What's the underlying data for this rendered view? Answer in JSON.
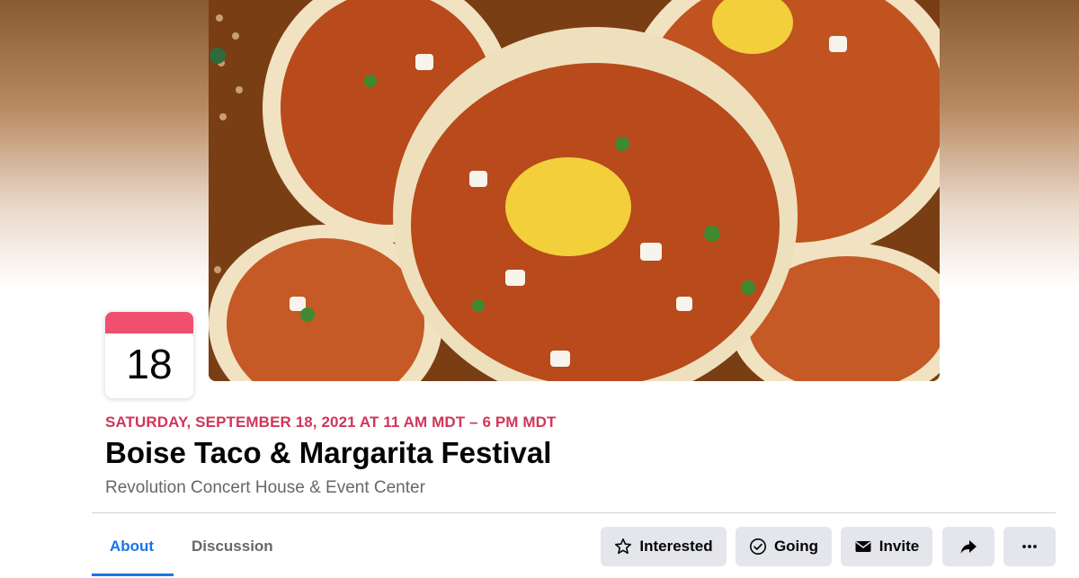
{
  "calendar": {
    "day": "18",
    "accent_color": "#f0506e"
  },
  "event": {
    "datetime": "SATURDAY, SEPTEMBER 18, 2021 AT 11 AM MDT – 6 PM MDT",
    "title": "Boise Taco & Margarita Festival",
    "venue": "Revolution Concert House & Event Center",
    "date_color": "#d0365a"
  },
  "tabs": [
    {
      "label": "About",
      "active": true
    },
    {
      "label": "Discussion",
      "active": false
    }
  ],
  "actions": {
    "interested": {
      "label": "Interested",
      "icon": "star-icon"
    },
    "going": {
      "label": "Going",
      "icon": "check-circle-icon"
    },
    "invite": {
      "label": "Invite",
      "icon": "envelope-icon"
    },
    "share": {
      "icon": "share-arrow-icon"
    },
    "more": {
      "icon": "more-dots-icon"
    }
  },
  "colors": {
    "tab_active": "#1b74e4",
    "button_bg": "#e4e6eb"
  }
}
